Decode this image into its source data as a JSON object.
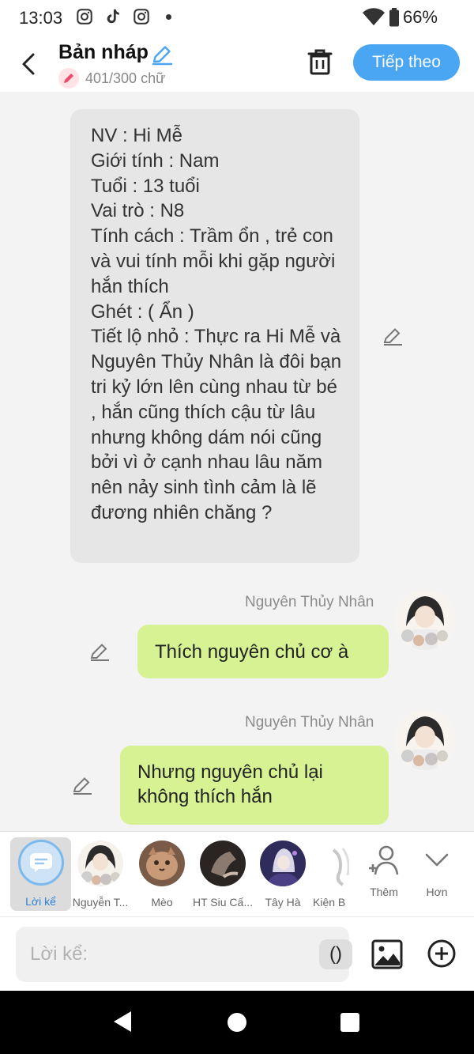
{
  "status_bar": {
    "time": "13:03",
    "battery": "66%",
    "icons": [
      "instagram-icon",
      "tiktok-icon",
      "instagram-icon",
      "dot-icon",
      "wifi-icon",
      "battery-icon"
    ]
  },
  "header": {
    "title": "Bản nháp",
    "word_count": "401/300 chữ",
    "next_label": "Tiếp theo",
    "accent_color": "#4aa6f3"
  },
  "narration": {
    "text": "NV : Hi Mễ\nGiới tính : Nam\nTuổi : 13 tuổi\nVai trò : N8\nTính cách : Trầm ổn , trẻ con và vui tính mỗi khi gặp người hắn thích\nGhét : ( Ẩn )\nTiết lộ nhỏ : Thực ra Hi Mễ và Nguyên Thủy Nhân là đôi bạn tri kỷ lớn lên cùng nhau từ bé , hắn cũng thích cậu từ lâu nhưng không dám nói cũng bởi vì ở cạnh nhau lâu năm nên nảy sinh tình cảm là lẽ đương nhiên chăng ?"
  },
  "messages": [
    {
      "sender": "Nguyên Thủy Nhân",
      "text": "Thích nguyên chủ cơ à"
    },
    {
      "sender": "Nguyên Thủy Nhân",
      "text": "Nhưng nguyên chủ lại\nkhông thích hắn"
    }
  ],
  "characters": [
    {
      "label": "Lời kể",
      "active": true
    },
    {
      "label": "Nguyễn T..."
    },
    {
      "label": "Mèo"
    },
    {
      "label": "HT Siu Cấ..."
    },
    {
      "label": "Tây Hà"
    },
    {
      "label": "Kiện B"
    },
    {
      "label": "Thêm"
    },
    {
      "label": "Hơn"
    }
  ],
  "composer": {
    "placeholder": "Lời kể:",
    "paren_label": "()"
  },
  "colors": {
    "bubble_green": "#d6f292",
    "narration_gray": "#e6e6e6",
    "active_label_blue": "#2a83d8"
  }
}
